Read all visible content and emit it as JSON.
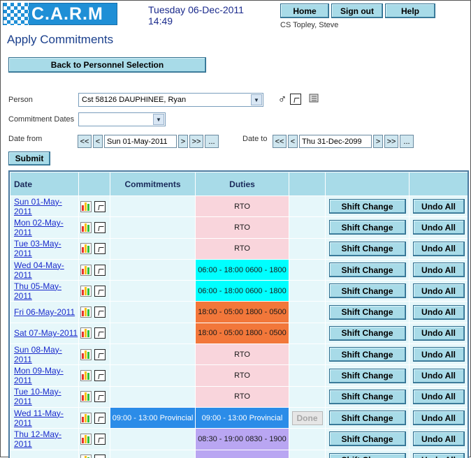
{
  "header": {
    "logo_text": "C.A.R.M",
    "date_line": "Tuesday 06-Dec-2011",
    "time_line": "14:49",
    "user": "CS Topley, Steve",
    "nav": [
      {
        "label": "Home"
      },
      {
        "label": "Sign out"
      },
      {
        "label": "Help"
      }
    ]
  },
  "page": {
    "title": "Apply Commitments",
    "back_label": "Back to Personnel Selection"
  },
  "form": {
    "person_label": "Person",
    "person_value": "Cst 58126 DAUPHINEE, Ryan",
    "commitment_dates_label": "Commitment Dates",
    "commitment_dates_value": "",
    "date_from_label": "Date from",
    "date_from_value": "Sun 01-May-2011",
    "date_to_label": "Date to",
    "date_to_value": "Thu 31-Dec-2099",
    "nav_first": "<<",
    "nav_prev": "<",
    "nav_next": ">",
    "nav_last": ">>",
    "nav_pick": "...",
    "submit_label": "Submit",
    "icons": [
      "male-gender-icon",
      "note-icon",
      "notebook-icon"
    ]
  },
  "table": {
    "headers": [
      "Date",
      "",
      "Commitments",
      "Duties",
      "",
      "",
      ""
    ],
    "shift_change_label": "Shift Change",
    "undo_all_label": "Undo All",
    "done_label": "Done",
    "colors": {
      "rto": "#f9d5dc",
      "day": "#00ffff",
      "night": "#f2773a",
      "provincial": "#2b8ce8",
      "light_purple": "#b9a6f2",
      "blank": "#e6f7fa"
    },
    "rows": [
      {
        "date": "Sun 01-May-2011",
        "commitment": "",
        "duty": "RTO",
        "duty_kind": "rto",
        "done": false
      },
      {
        "date": "Mon 02-May-2011",
        "commitment": "",
        "duty": "RTO",
        "duty_kind": "rto",
        "done": false
      },
      {
        "date": "Tue 03-May-2011",
        "commitment": "",
        "duty": "RTO",
        "duty_kind": "rto",
        "done": false
      },
      {
        "date": "Wed 04-May-2011",
        "commitment": "",
        "duty": "06:00 - 18:00 0600 - 1800",
        "duty_kind": "day",
        "done": false
      },
      {
        "date": "Thu 05-May-2011",
        "commitment": "",
        "duty": "06:00 - 18:00 0600 - 1800",
        "duty_kind": "day",
        "done": false
      },
      {
        "date": "Fri 06-May-2011",
        "commitment": "",
        "duty": "18:00 - 05:00 1800 - 0500",
        "duty_kind": "night",
        "done": false
      },
      {
        "date": "Sat 07-May-2011",
        "commitment": "",
        "duty": "18:00 - 05:00 1800 - 0500",
        "duty_kind": "night",
        "done": false
      },
      {
        "date": "Sun 08-May-2011",
        "commitment": "",
        "duty": "RTO",
        "duty_kind": "rto",
        "done": false
      },
      {
        "date": "Mon 09-May-2011",
        "commitment": "",
        "duty": "RTO",
        "duty_kind": "rto",
        "done": false
      },
      {
        "date": "Tue 10-May-2011",
        "commitment": "",
        "duty": "RTO",
        "duty_kind": "rto",
        "done": false
      },
      {
        "date": "Wed 11-May-2011",
        "commitment": "09:00 - 13:00 Provincial",
        "duty": "09:00 - 13:00 Provincial",
        "duty_kind": "provincial",
        "done": true
      },
      {
        "date": "Thu 12-May-2011",
        "commitment": "",
        "duty": "08:30 - 19:00 0830 - 1900",
        "duty_kind": "light_purple",
        "done": false
      },
      {
        "date": "",
        "commitment": "",
        "duty": "",
        "duty_kind": "light_purple",
        "done": false
      }
    ]
  }
}
